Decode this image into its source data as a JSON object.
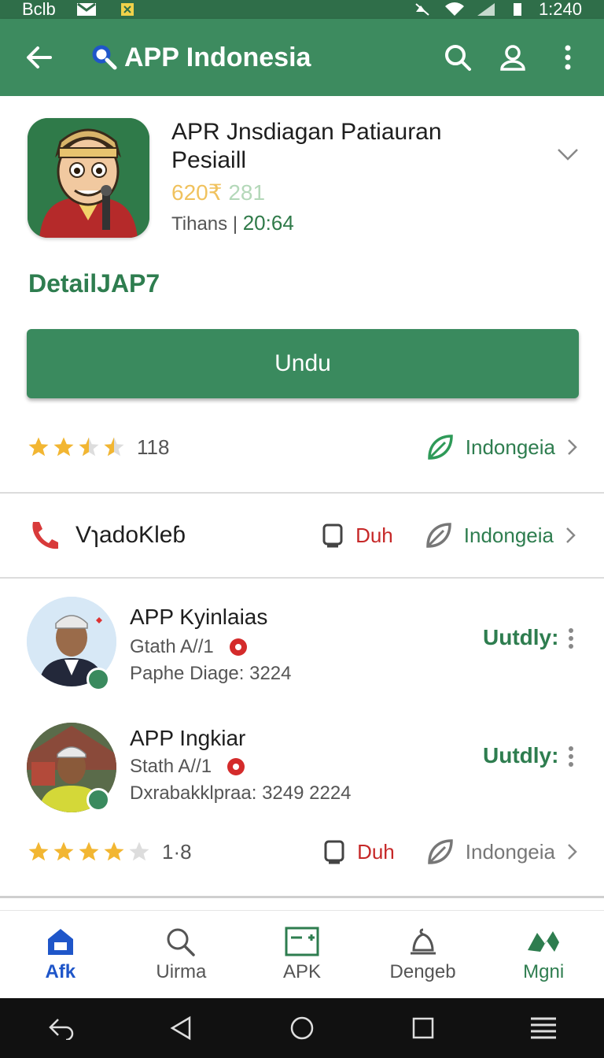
{
  "status_bar": {
    "carrier": "Bclb",
    "time": "1:240"
  },
  "app_bar": {
    "title": "APP Indonesia"
  },
  "app": {
    "name": "APR Jnsdiagan Patiauran Pesiaill",
    "price_primary": "620₹",
    "price_secondary": "281",
    "meta_label": "Tihans |",
    "meta_time": "20:64",
    "section_title": "DetailJAP7",
    "download_label": "Undu",
    "rating_count": "118",
    "region_label": "Indongeia"
  },
  "contact": {
    "label": "VɿadoKleɓ",
    "action_label": "Duh",
    "region_label": "Indongeia"
  },
  "list": [
    {
      "title": "APP Kyinlaias",
      "subtitle": "Gtath A//1",
      "detail": "Paphe Diage: 3224",
      "status": "Uutdly:"
    },
    {
      "title": "APP Ingkiar",
      "subtitle": "Stath A//1",
      "detail": "Dxrabakklpraa: 3249 2224",
      "status": "Uutdly:"
    }
  ],
  "footer": {
    "rating_count": "1·8",
    "action_label": "Duh",
    "region_label": "Indongeia"
  },
  "bottom_nav": [
    {
      "label": "Afk"
    },
    {
      "label": "Uirma"
    },
    {
      "label": "APK"
    },
    {
      "label": "Dengeb"
    },
    {
      "label": "Mgni"
    }
  ],
  "colors": {
    "primary": "#3d8b5f",
    "accent_blue": "#1f56c9",
    "red": "#c62828",
    "star": "#f2b632"
  }
}
